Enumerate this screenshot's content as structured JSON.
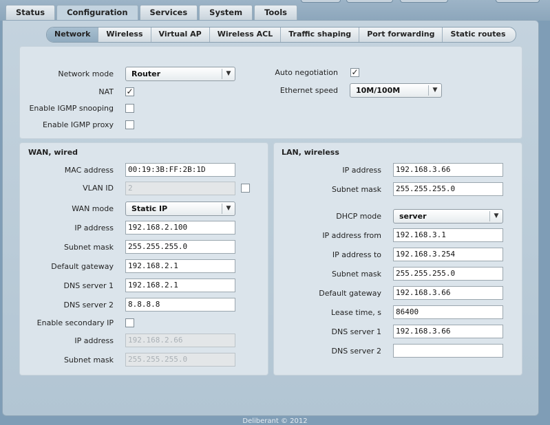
{
  "main_tabs": [
    "Status",
    "Configuration",
    "Services",
    "System",
    "Tools"
  ],
  "sub_tabs": [
    "Network",
    "Wireless",
    "Virtual AP",
    "Wireless ACL",
    "Traffic shaping",
    "Port forwarding",
    "Static routes"
  ],
  "general": {
    "network_mode_label": "Network mode",
    "network_mode_value": "Router",
    "nat_label": "NAT",
    "igmp_snooping_label": "Enable IGMP snooping",
    "igmp_proxy_label": "Enable IGMP proxy",
    "auto_negotiation_label": "Auto negotiation",
    "ethernet_speed_label": "Ethernet speed",
    "ethernet_speed_value": "10M/100M"
  },
  "wan": {
    "title": "WAN, wired",
    "mac_label": "MAC address",
    "mac_value": "00:19:3B:FF:2B:1D",
    "vlan_label": "VLAN ID",
    "vlan_value": "2",
    "wan_mode_label": "WAN mode",
    "wan_mode_value": "Static IP",
    "ip_label": "IP address",
    "ip_value": "192.168.2.100",
    "mask_label": "Subnet mask",
    "mask_value": "255.255.255.0",
    "gw_label": "Default gateway",
    "gw_value": "192.168.2.1",
    "dns1_label": "DNS server 1",
    "dns1_value": "192.168.2.1",
    "dns2_label": "DNS server 2",
    "dns2_value": "8.8.8.8",
    "secondary_label": "Enable secondary IP",
    "sec_ip_label": "IP address",
    "sec_ip_value": "192.168.2.66",
    "sec_mask_label": "Subnet mask",
    "sec_mask_value": "255.255.255.0"
  },
  "lan": {
    "title": "LAN, wireless",
    "ip_label": "IP address",
    "ip_value": "192.168.3.66",
    "mask_label": "Subnet mask",
    "mask_value": "255.255.255.0",
    "dhcp_label": "DHCP mode",
    "dhcp_value": "server",
    "from_label": "IP address from",
    "from_value": "192.168.3.1",
    "to_label": "IP address to",
    "to_value": "192.168.3.254",
    "dmask_label": "Subnet mask",
    "dmask_value": "255.255.255.0",
    "dgw_label": "Default gateway",
    "dgw_value": "192.168.3.66",
    "lease_label": "Lease time, s",
    "lease_value": "86400",
    "dns1_label": "DNS server 1",
    "dns1_value": "192.168.3.66",
    "dns2_label": "DNS server 2",
    "dns2_value": ""
  },
  "footer": "Deliberant © 2012",
  "icons": {
    "check": "✓",
    "dropdown": "▼"
  }
}
